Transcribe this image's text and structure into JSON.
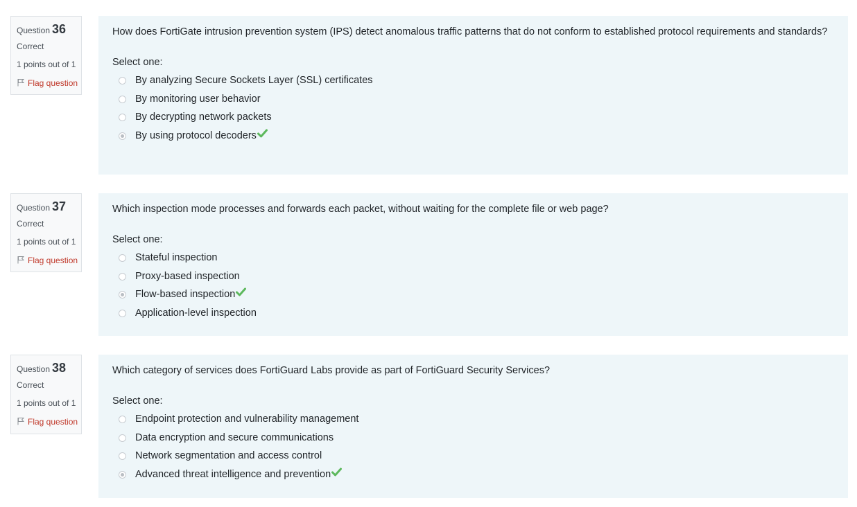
{
  "questions": [
    {
      "word": "Question",
      "number": "36",
      "state": "Correct",
      "grade": "1 points out of 1",
      "flag_label": "Flag question",
      "text": "How does FortiGate intrusion prevention system (IPS) detect anomalous traffic patterns that do not conform to established protocol requirements and standards?",
      "prompt": "Select one:",
      "answers": [
        {
          "label": "By analyzing Secure Sockets Layer (SSL) certificates",
          "selected": false,
          "correct": false
        },
        {
          "label": "By monitoring user behavior",
          "selected": false,
          "correct": false
        },
        {
          "label": "By decrypting network packets",
          "selected": false,
          "correct": false
        },
        {
          "label": "By using protocol decoders",
          "selected": true,
          "correct": true
        }
      ]
    },
    {
      "word": "Question",
      "number": "37",
      "state": "Correct",
      "grade": "1 points out of 1",
      "flag_label": "Flag question",
      "text": "Which inspection mode processes and forwards each packet, without waiting for the complete file or web page?",
      "prompt": "Select one:",
      "answers": [
        {
          "label": "Stateful inspection",
          "selected": false,
          "correct": false
        },
        {
          "label": "Proxy-based inspection",
          "selected": false,
          "correct": false
        },
        {
          "label": "Flow-based inspection",
          "selected": true,
          "correct": true
        },
        {
          "label": "Application-level inspection",
          "selected": false,
          "correct": false
        }
      ]
    },
    {
      "word": "Question",
      "number": "38",
      "state": "Correct",
      "grade": "1 points out of 1",
      "flag_label": "Flag question",
      "text": "Which category of services does FortiGuard Labs provide as part of FortiGuard Security Services?",
      "prompt": "Select one:",
      "answers": [
        {
          "label": "Endpoint protection and vulnerability management",
          "selected": false,
          "correct": false
        },
        {
          "label": "Data encryption and secure communications",
          "selected": false,
          "correct": false
        },
        {
          "label": "Network segmentation and access control",
          "selected": false,
          "correct": false
        },
        {
          "label": "Advanced threat intelligence and prevention",
          "selected": true,
          "correct": true
        }
      ]
    }
  ],
  "colors": {
    "flag": "#c0392b",
    "correct_check": "#5cb85c",
    "content_bg": "#eef6f9",
    "info_bg": "#f8f9fa"
  },
  "icons": {
    "flag": "flag-icon",
    "correct": "check-icon"
  }
}
